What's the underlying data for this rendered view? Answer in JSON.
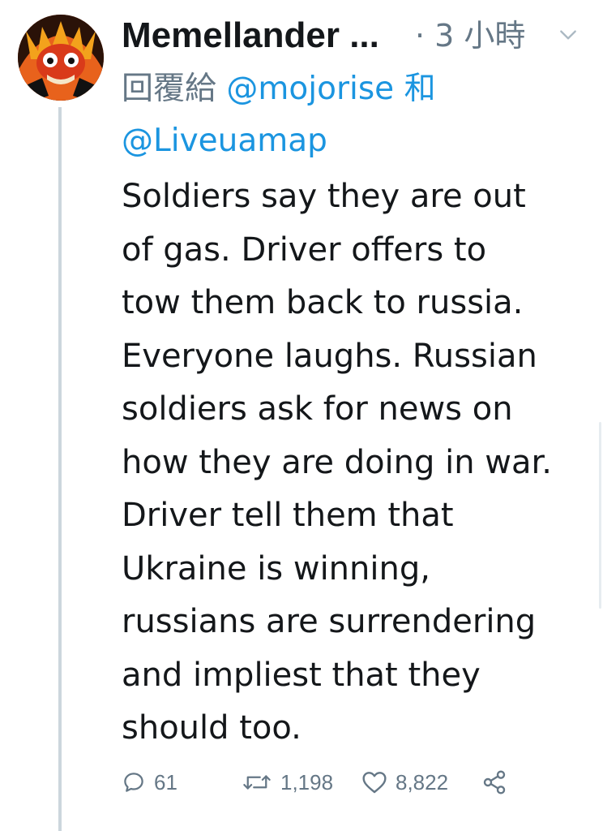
{
  "tweet": {
    "author_name": "Memellander ...",
    "time": "· 3 小時",
    "reply_prefix": "回覆給",
    "reply_mentions": [
      "@mojorise",
      "@Liveuamap"
    ],
    "reply_joiner": "和",
    "text": "Soldiers say they are out\nof gas. Driver offers to\ntow them back to russia.\nEveryone laughs. Russian\nsoldiers ask for news on\nhow they are doing in war.\nDriver tell them that\nUkraine is winning,\nrussians are surrendering\nand impliest that they\nshould too.",
    "counts": {
      "replies": "61",
      "retweets": "1,198",
      "likes": "8,822"
    }
  },
  "icons": {
    "avatar": "cartoon-character-avatar",
    "caret": "chevron-down-icon",
    "reply": "reply-icon",
    "retweet": "retweet-icon",
    "like": "heart-icon",
    "share": "share-icon"
  },
  "colors": {
    "text": "#14171a",
    "secondary": "#657786",
    "link": "#1b95e0",
    "thread_line": "#ccd6dd"
  }
}
